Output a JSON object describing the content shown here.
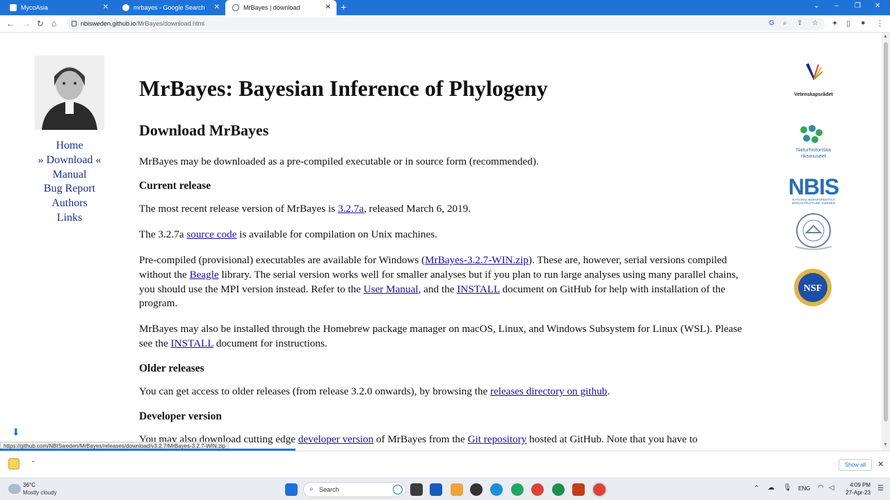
{
  "browser": {
    "tabs": [
      {
        "label": "MycoAsia",
        "active": false
      },
      {
        "label": "mrbayes - Google Search",
        "active": false
      },
      {
        "label": "MrBayes | download",
        "active": true
      }
    ],
    "url_host": "nbisweden.github.io",
    "url_path": "/MrBayes/download.html"
  },
  "sidebar": {
    "items": [
      "Home",
      "» Download «",
      "Manual",
      "Bug Report",
      "Authors",
      "Links"
    ]
  },
  "content": {
    "title": "MrBayes: Bayesian Inference of Phylogeny",
    "subtitle": "Download MrBayes",
    "intro": "MrBayes may be downloaded as a pre-compiled executable or in source form (recommended).",
    "current_heading": "Current release",
    "current_p1_a": "The most recent release version of MrBayes is ",
    "current_p1_link": "3.2.7a",
    "current_p1_b": ", released March 6, 2019.",
    "current_p2_a": "The 3.2.7a ",
    "current_p2_link": "source code",
    "current_p2_b": " is available for compilation on Unix machines.",
    "current_p3_a": "Pre-compiled (provisional) executables are available for Windows (",
    "current_p3_link1": "MrBayes-3.2.7-WIN.zip",
    "current_p3_b": "). These are, however, serial versions compiled without the ",
    "current_p3_link2": "Beagle",
    "current_p3_c": " library. The serial version works well for smaller analyses but if you plan to run large analyses using many parallel chains, you should use the MPI version instead. Refer to the ",
    "current_p3_link3": "User Manual",
    "current_p3_d": ", and the ",
    "current_p3_link4": "INSTALL",
    "current_p3_e": " document on GitHub for help with installation of the program.",
    "current_p4_a": "MrBayes may also be installed through the Homebrew package manager on macOS, Linux, and Windows Subsystem for Linux (WSL). Please see the ",
    "current_p4_link": "INSTALL",
    "current_p4_b": " document for instructions.",
    "older_heading": "Older releases",
    "older_p_a": "You can get access to older releases (from release 3.2.0 onwards), by browsing the ",
    "older_p_link": "releases directory on github",
    "older_p_b": ".",
    "dev_heading": "Developer version",
    "dev_p_a": "You may also download cutting edge ",
    "dev_p_link1": "developer version",
    "dev_p_b": " of MrBayes from the ",
    "dev_p_link2": "Git repository",
    "dev_p_c": " hosted at GitHub. Note that you have to"
  },
  "logos": {
    "vr": "Vetenskapsrådet",
    "nrm_1": "Naturhistoriska",
    "nrm_2": "riksmuseet",
    "nbis": "NBIS",
    "nbis_sub": "NATIONAL BIOINFORMATICS INFRASTRUCTURE SWEDEN",
    "nih": "NATIONAL INSTITUTES OF HEALTH",
    "nsf": "NSF"
  },
  "status_url": "https://github.com/NBISweden/MrBayes/releases/download/v3.2.7/MrBayes-3.2.7-WIN.zip",
  "download_shelf": {
    "show_all": "Show all"
  },
  "taskbar": {
    "weather_temp": "36°C",
    "weather_desc": "Mostly cloudy",
    "search_placeholder": "Search",
    "lang": "ENG",
    "time": "4:09 PM",
    "date": "27-Apr-23"
  }
}
